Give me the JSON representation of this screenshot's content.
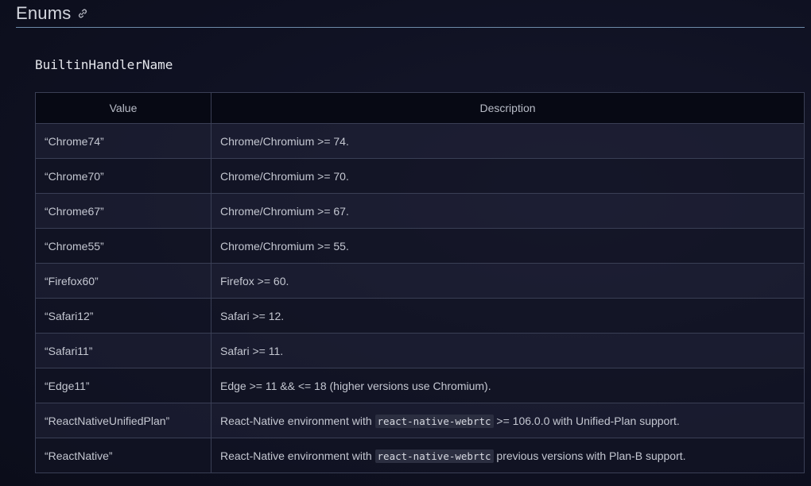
{
  "section": {
    "title": "Enums",
    "link_icon": "link-icon"
  },
  "enum_name": "BuiltinHandlerName",
  "table": {
    "headers": [
      "Value",
      "Description"
    ],
    "rows": [
      {
        "value": "“Chrome74”",
        "desc_pre": "Chrome/Chromium >= 74.",
        "code": "",
        "desc_post": ""
      },
      {
        "value": "“Chrome70”",
        "desc_pre": "Chrome/Chromium >= 70.",
        "code": "",
        "desc_post": ""
      },
      {
        "value": "“Chrome67”",
        "desc_pre": "Chrome/Chromium >= 67.",
        "code": "",
        "desc_post": ""
      },
      {
        "value": "“Chrome55”",
        "desc_pre": "Chrome/Chromium >= 55.",
        "code": "",
        "desc_post": ""
      },
      {
        "value": "“Firefox60”",
        "desc_pre": "Firefox >= 60.",
        "code": "",
        "desc_post": ""
      },
      {
        "value": "“Safari12”",
        "desc_pre": "Safari >= 12.",
        "code": "",
        "desc_post": ""
      },
      {
        "value": "“Safari11”",
        "desc_pre": "Safari >= 11.",
        "code": "",
        "desc_post": ""
      },
      {
        "value": "“Edge11”",
        "desc_pre": "Edge >= 11 && <= 18 (higher versions use Chromium).",
        "code": "",
        "desc_post": ""
      },
      {
        "value": "“ReactNativeUnifiedPlan”",
        "desc_pre": "React-Native environment with ",
        "code": "react-native-webrtc",
        "desc_post": " >= 106.0.0 with Unified-Plan support."
      },
      {
        "value": "“ReactNative”",
        "desc_pre": "React-Native environment with ",
        "code": "react-native-webrtc",
        "desc_post": " previous versions with Plan-B support."
      }
    ]
  }
}
